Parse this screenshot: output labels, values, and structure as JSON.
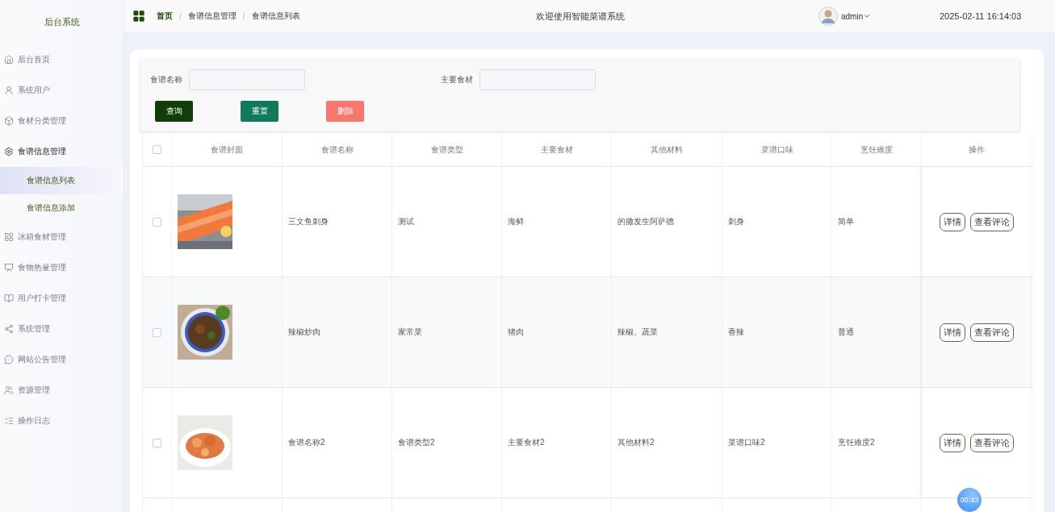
{
  "sidebar": {
    "title": "后台系统",
    "items": [
      {
        "label": "后台首页",
        "expanded": false
      },
      {
        "label": "系统用户",
        "expanded": false
      },
      {
        "label": "食材分类管理",
        "expanded": false
      },
      {
        "label": "食谱信息管理",
        "expanded": true,
        "children": [
          {
            "label": "食谱信息列表",
            "selected": true
          },
          {
            "label": "食谱信息添加",
            "selected": false
          }
        ]
      },
      {
        "label": "冰箱食材管理",
        "expanded": false
      },
      {
        "label": "食物热量管理",
        "expanded": false
      },
      {
        "label": "用户打卡管理",
        "expanded": false
      },
      {
        "label": "系统管理",
        "expanded": false
      },
      {
        "label": "网站公告管理",
        "expanded": false
      },
      {
        "label": "资源管理",
        "expanded": false
      },
      {
        "label": "操作日志",
        "expanded": false
      }
    ]
  },
  "header": {
    "breadcrumb": [
      "首页",
      "/",
      "食谱信息管理",
      "/",
      "食谱信息列表"
    ],
    "title": "欢迎使用智能菜谱系统",
    "user": "admin",
    "datetime": "2025-02-11 16:14:03"
  },
  "search": {
    "fields": [
      {
        "label": "食谱名称"
      },
      {
        "label": "主要食材"
      }
    ],
    "buttons": [
      {
        "label": "查询",
        "kind": "query"
      },
      {
        "label": "重置",
        "kind": "reset"
      },
      {
        "label": "删除",
        "kind": "delete"
      }
    ]
  },
  "table": {
    "all_checked": false,
    "columns": [
      "食谱封面",
      "食谱名称",
      "食谱类型",
      "主要食材",
      "其他材料",
      "菜谱口味",
      "烹饪难度",
      "操作"
    ],
    "rows": [
      {
        "checked": false,
        "cover": {
          "kind": "picture"
        },
        "cells": [
          "三文鱼刺身",
          "测试",
          "海鲜",
          "的撒发生阿萨德",
          "刺身",
          "简单"
        ],
        "actions": [
          "详情",
          "查看评论"
        ]
      },
      {
        "checked": false,
        "cover": {
          "kind": "picture"
        },
        "cells": [
          "辣椒炒肉",
          "家常菜",
          "猪肉",
          "辣椒、蔬菜",
          "香辣",
          "普通"
        ],
        "actions": [
          "详情",
          "查看评论"
        ]
      },
      {
        "checked": false,
        "cover": {
          "kind": "picture"
        },
        "cells": [
          "食谱名称2",
          "食谱类型2",
          "主要食材2",
          "其他材料2",
          "菜谱口味2",
          "烹饪难度2"
        ],
        "actions": [
          "详情",
          "查看评论"
        ]
      }
    ]
  },
  "recorder": {
    "time": "00:43"
  }
}
